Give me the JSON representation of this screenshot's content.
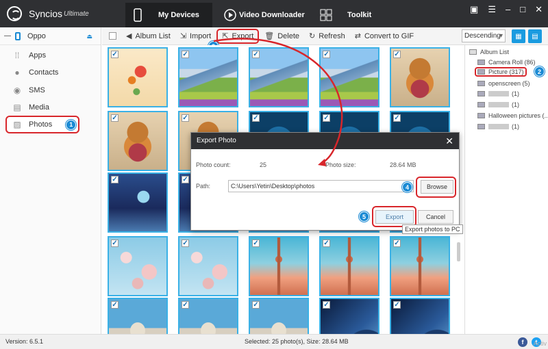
{
  "app": {
    "name": "Syncios",
    "edition": "Ultimate"
  },
  "nav": {
    "my_devices": "My Devices",
    "video_downloader": "Video Downloader",
    "toolkit": "Toolkit"
  },
  "window_buttons": {
    "feedback": "▣",
    "menu": "☰",
    "minimize": "–",
    "maximize": "□",
    "close": "✕"
  },
  "sidebar": {
    "device": "Oppo",
    "items": [
      {
        "label": "Apps"
      },
      {
        "label": "Contacts"
      },
      {
        "label": "SMS"
      },
      {
        "label": "Media"
      },
      {
        "label": "Photos",
        "badge": "1"
      }
    ]
  },
  "toolbar": {
    "album_list": "Album List",
    "import": "Import",
    "export": "Export",
    "export_badge": "3",
    "delete": "Delete",
    "refresh": "Refresh",
    "convert": "Convert to GIF",
    "sort": "Descending"
  },
  "albums": {
    "header": "Album List",
    "items": [
      {
        "label": "Camera Roll (86)"
      },
      {
        "label": "Picture (317)",
        "badge": "2"
      },
      {
        "label": "openscreen (5)"
      },
      {
        "label": "(1)"
      },
      {
        "label": "(1)"
      },
      {
        "label": "Halloween pictures (..."
      },
      {
        "label": "(1)"
      }
    ]
  },
  "grid": {
    "checkmark": "✓",
    "images": [
      "flower",
      "mountain",
      "mountain",
      "mountain",
      "bear",
      "bear",
      "bear",
      "blue",
      "blue",
      "blue",
      "fantasy",
      "fantasy",
      "fantasy",
      "fantasy",
      "fantasy",
      "blossom",
      "blossom",
      "tower",
      "tower",
      "tower",
      "church",
      "church",
      "church",
      "planet",
      "planet"
    ]
  },
  "dialog": {
    "title": "Export Photo",
    "photo_count_label": "Photo count:",
    "photo_count": "25",
    "photo_size_label": "Photo size:",
    "photo_size": "28.64 MB",
    "path_label": "Path:",
    "path_value": "C:\\Users\\Yetin\\Desktop\\photos",
    "browse": "Browse",
    "browse_badge": "4",
    "export": "Export",
    "export_badge": "5",
    "cancel": "Cancel",
    "tooltip": "Export photos to PC"
  },
  "status": {
    "version": "Version: 6.5.1",
    "selection": "Selected: 25 photo(s), Size: 28.64 MB",
    "facebook": "f",
    "twitter": "t",
    "watermark": "Activ"
  },
  "colors": {
    "accent": "#1a9be0",
    "highlight": "#d8262b",
    "titlebar": "#2f3033"
  }
}
